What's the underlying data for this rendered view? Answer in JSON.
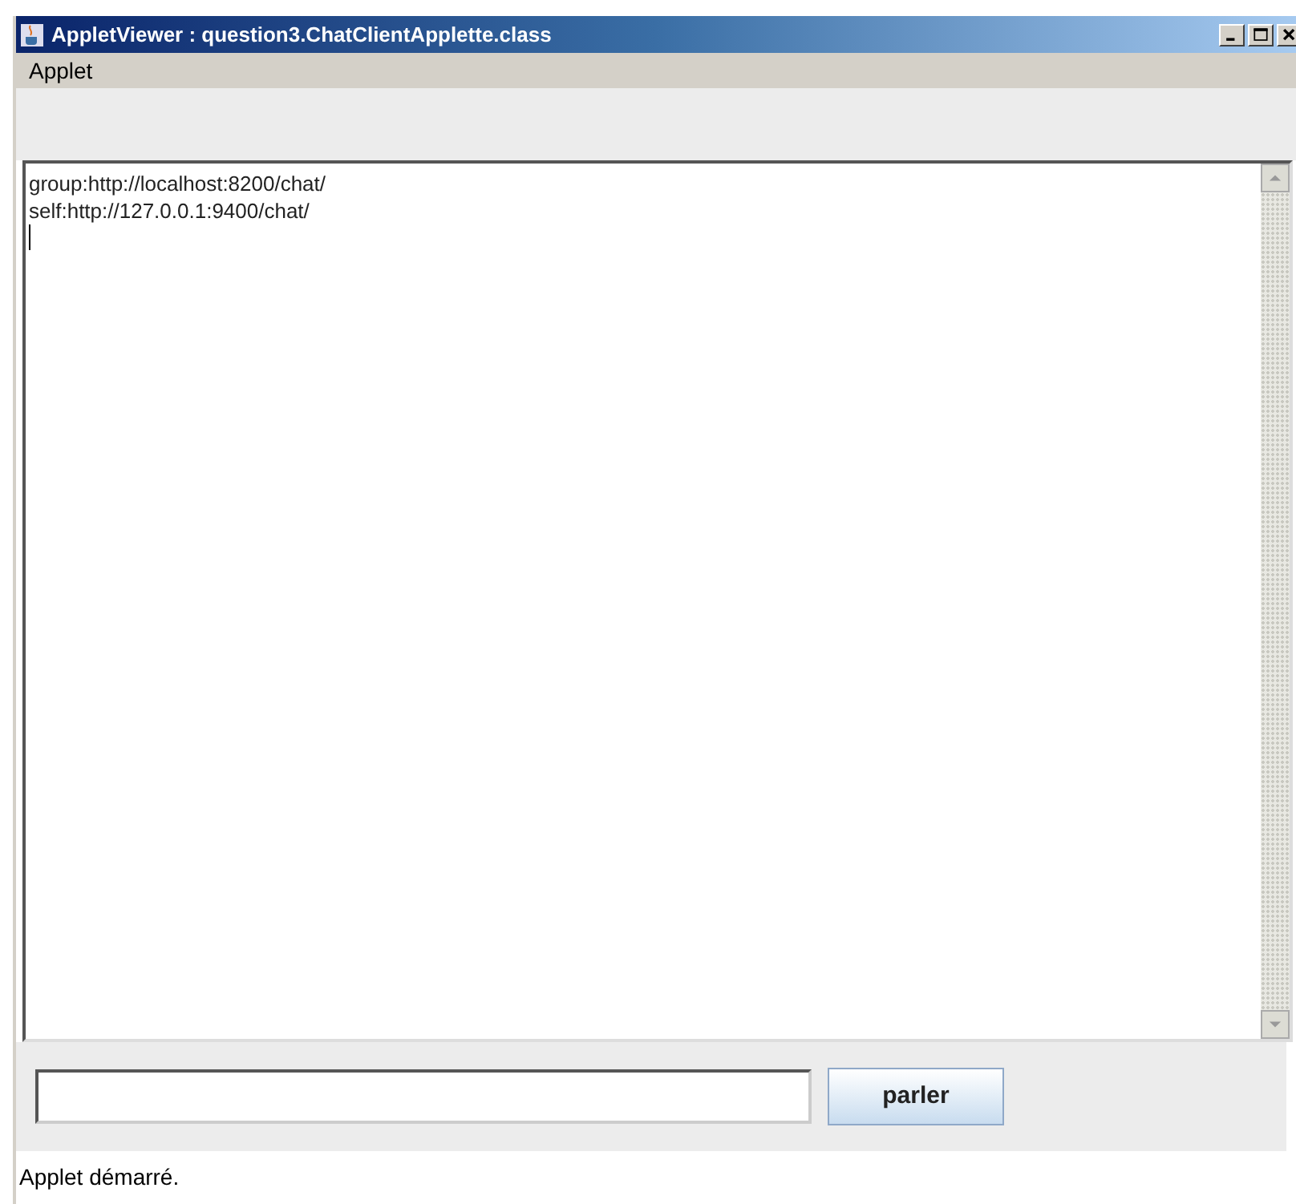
{
  "window": {
    "title": "AppletViewer : question3.ChatClientApplette.class"
  },
  "menu": [
    "Applet"
  ],
  "chat_log": {
    "lines": [
      "group:http://localhost:8200/chat/",
      "self:http://127.0.0.1:9400/chat/"
    ]
  },
  "send_button": "parler",
  "status_bar": "Applet démarré."
}
